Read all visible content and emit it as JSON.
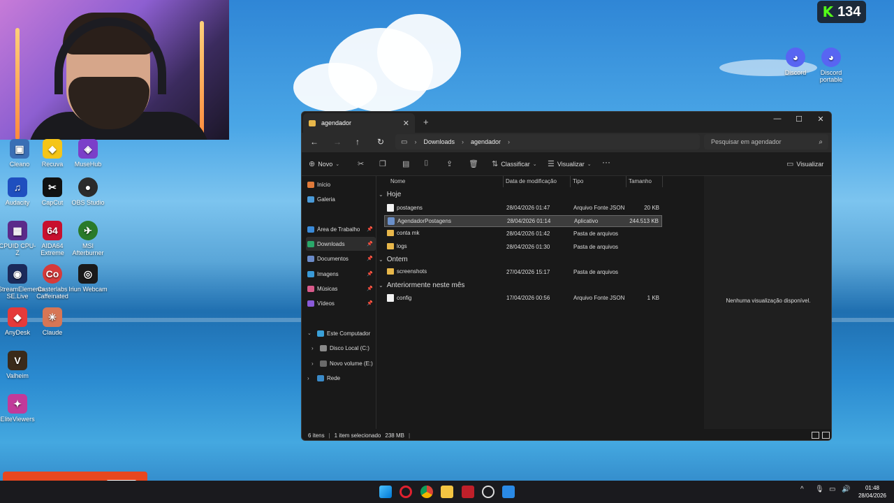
{
  "counter": {
    "value": "134",
    "logo": "K"
  },
  "desktop_icons": [
    {
      "label": "Cleano",
      "color": "#3a6fb5"
    },
    {
      "label": "Recuva",
      "color": "#f5c518"
    },
    {
      "label": "MuseHub",
      "color": "#7b3fc9"
    },
    {
      "label": "Audacity",
      "color": "#1f4fbf"
    },
    {
      "label": "CapCut",
      "color": "#111111"
    },
    {
      "label": "OBS Studio",
      "color": "#2b2b2b"
    },
    {
      "label": "CPUID CPU-Z",
      "color": "#5b2a8a"
    },
    {
      "label": "AIDA64 Extreme",
      "color": "#c8102e"
    },
    {
      "label": "MSI Afterburner",
      "color": "#2a7a2a"
    },
    {
      "label": "StreamElements SE.Live",
      "color": "#1b2a5a"
    },
    {
      "label": "Casterlabs Caffeinated",
      "color": "#d63a3a"
    },
    {
      "label": "Iriun Webcam",
      "color": "#1a1a1a"
    },
    {
      "label": "AnyDesk",
      "color": "#e53a3a"
    },
    {
      "label": "Claude",
      "color": "#d77655"
    },
    {
      "label": "Valheim",
      "color": "#3a2a1a"
    },
    {
      "label": "EliteViewers",
      "color": "#c23a9a"
    },
    {
      "label": "Discord",
      "color": "#5865f2"
    },
    {
      "label": "Discord portable",
      "color": "#5865f2"
    }
  ],
  "icon_glyphs": [
    "▣",
    "◆",
    "◈",
    "♫",
    "✂",
    "●",
    "▦",
    "64",
    "✈",
    "◉",
    "Co",
    "◎",
    "◆",
    "✳",
    "V",
    "✦",
    "◕",
    "◕"
  ],
  "explorer": {
    "tab_title": "agendador",
    "new_tab": "+",
    "window_controls": [
      "—",
      "☐",
      "✕"
    ],
    "breadcrumb": [
      "Downloads",
      "agendador"
    ],
    "search_placeholder": "Pesquisar em agendador",
    "toolbar": {
      "new": "Novo",
      "sort": "Classificar",
      "view": "Visualizar",
      "more": "···",
      "details_pane": "Visualizar"
    },
    "nav": {
      "home": "Início",
      "gallery": "Galeria",
      "desktop": "Área de Trabalho",
      "downloads": "Downloads",
      "documents": "Documentos",
      "pictures": "Imagens",
      "music": "Músicas",
      "videos": "Vídeos",
      "this_pc": "Este Computador",
      "drive_c": "Disco Local (C:)",
      "drive_e": "Novo volume (E:)",
      "network": "Rede"
    },
    "columns": [
      "Nome",
      "Data de modificação",
      "Tipo",
      "Tamanho"
    ],
    "groups": [
      {
        "title": "Hoje",
        "files": [
          {
            "name": "postagens",
            "date": "28/04/2026 01:47",
            "type": "Arquivo Fonte JSON",
            "size": "20 KB",
            "icon": "doc"
          },
          {
            "name": "AgendadorPostagens",
            "date": "28/04/2026 01:14",
            "type": "Aplicativo",
            "size": "244.513 KB",
            "icon": "app",
            "selected": true
          },
          {
            "name": "conta mk",
            "date": "28/04/2026 01:42",
            "type": "Pasta de arquivos",
            "size": "",
            "icon": "folder"
          },
          {
            "name": "logs",
            "date": "28/04/2026 01:30",
            "type": "Pasta de arquivos",
            "size": "",
            "icon": "folder"
          }
        ]
      },
      {
        "title": "Ontem",
        "files": [
          {
            "name": "screenshots",
            "date": "27/04/2026 15:17",
            "type": "Pasta de arquivos",
            "size": "",
            "icon": "folder"
          }
        ]
      },
      {
        "title": "Anteriormente neste mês",
        "files": [
          {
            "name": "config",
            "date": "17/04/2026 00:56",
            "type": "Arquivo Fonte JSON",
            "size": "1 KB",
            "icon": "doc"
          }
        ]
      }
    ],
    "preview_message": "Nenhuma visualização disponível.",
    "status": {
      "count": "6 itens",
      "selection": "1 item selecionado",
      "selection_size": "238 MB"
    }
  },
  "taskbar": {
    "apps": [
      "windows-start",
      "opera",
      "chrome",
      "file-explorer",
      "twitter-overlay",
      "obs",
      "vscode"
    ],
    "time": "01:48",
    "date": "28/04/2026"
  }
}
